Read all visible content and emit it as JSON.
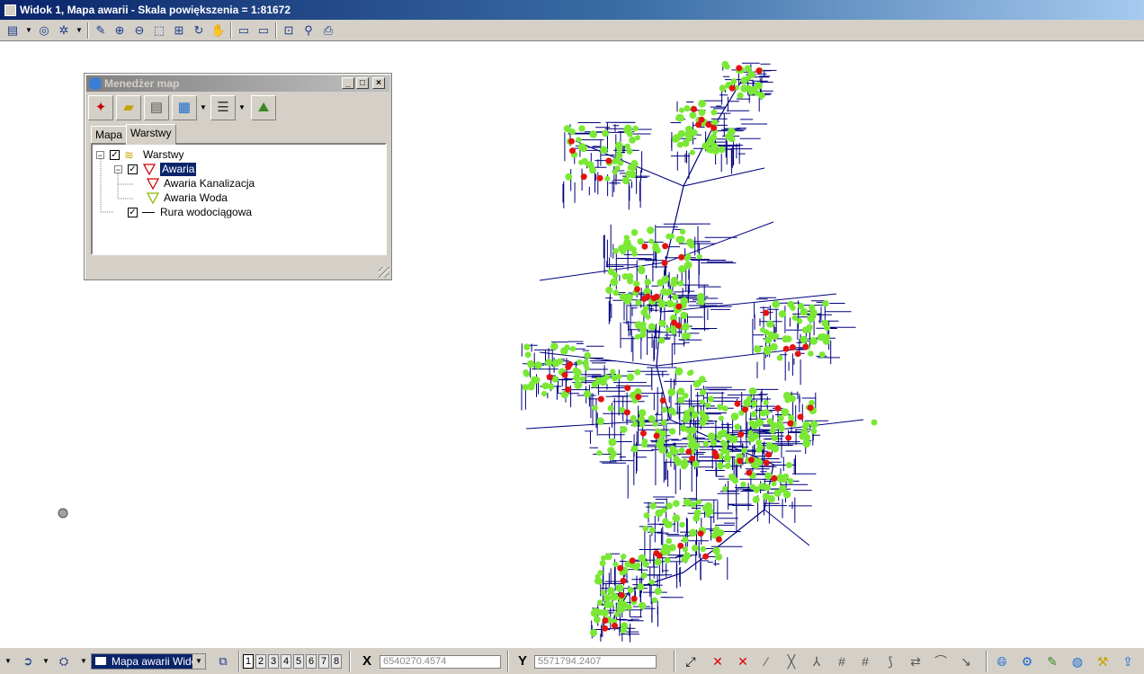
{
  "window": {
    "title": "Widok 1, Mapa awarii - Skala powiększenia = 1:81672"
  },
  "toolbar": {
    "icons": [
      "layer-control-icon",
      "dropdown-arrow-icon",
      "globe-icon",
      "sun-icon",
      "dropdown-arrow-icon",
      "pen-icon",
      "zoom-in-icon",
      "zoom-out-icon",
      "zoom-rectangle-icon",
      "zoom-extent-icon",
      "refresh-icon",
      "pan-hand-icon",
      "view-previous-icon",
      "view-next-icon",
      "select-feature-icon",
      "info-tool-icon",
      "print-icon"
    ]
  },
  "map_manager": {
    "title": "Menedżer map",
    "tabs": [
      {
        "label": "Mapa"
      },
      {
        "label": "Warstwy"
      }
    ],
    "active_tab": "Warstwy",
    "tree": {
      "root": {
        "label": "Warstwy",
        "checked": true,
        "expanded": true
      },
      "group": {
        "label": "Awaria",
        "checked": true,
        "expanded": true,
        "selected": true
      },
      "children": [
        {
          "label": "Awaria Kanalizacja",
          "color": "#cc0000"
        },
        {
          "label": "Awaria Woda",
          "color": "#8ab800"
        }
      ],
      "layer": {
        "label": "Rura wodociągowa",
        "checked": true
      }
    }
  },
  "map": {
    "colors": {
      "pipes": "#00007f",
      "water_failure": "#7ae835",
      "sewer_failure": "#e31212"
    }
  },
  "statusbar": {
    "view_name": "Mapa awarii Widok",
    "pages": [
      "1",
      "2",
      "3",
      "4",
      "5",
      "6",
      "7",
      "8"
    ],
    "active_page": "1",
    "x_label": "X",
    "x_value": "6540270.4574",
    "y_label": "Y",
    "y_value": "5571794.2407"
  }
}
